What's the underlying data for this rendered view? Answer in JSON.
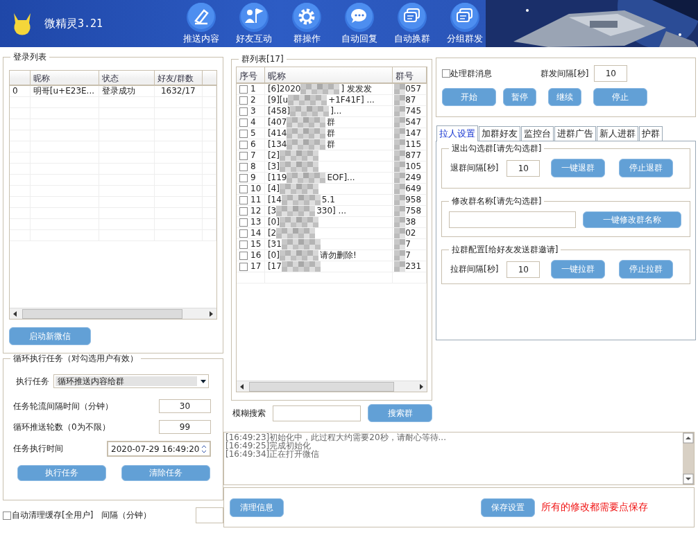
{
  "app": {
    "title": "微精灵",
    "version": "3.21"
  },
  "toolbar": [
    {
      "label": "推送内容"
    },
    {
      "label": "好友互动"
    },
    {
      "label": "群操作"
    },
    {
      "label": "自动回复"
    },
    {
      "label": "自动换群"
    },
    {
      "label": "分组群发"
    }
  ],
  "login_list": {
    "title": "登录列表",
    "columns": [
      "昵称",
      "状态",
      "好友/群数"
    ],
    "rows": [
      {
        "index": "0",
        "name": "明哥[u+E23E...",
        "status": "登录成功",
        "counts": "1632/17"
      }
    ]
  },
  "launch_button": "启动新微信",
  "loop_task": {
    "title": "循环执行任务（对勾选用户有效）",
    "task_label": "执行任务",
    "task_value": "循环推送内容给群",
    "interval_label": "任务轮流间隔时间（分钟）",
    "interval_value": "30",
    "rounds_label": "循环推送轮数（0为不限）",
    "rounds_value": "99",
    "time_label": "任务执行时间",
    "time_value": "2020-07-29 16:49:20",
    "buttons": [
      "执行任务",
      "清除任务"
    ]
  },
  "auto_clean": {
    "label": "自动清理缓存[全用户]",
    "checked": false,
    "interval_label": "间隔（分钟）"
  },
  "group_list": {
    "title": "群列表[17]",
    "columns": [
      "序号",
      "昵称",
      "群号"
    ],
    "rows": [
      {
        "index": "1",
        "checked": false,
        "name_start": "[6]2020",
        "name_end": "] 发发发",
        "id_end": "057"
      },
      {
        "index": "2",
        "checked": false,
        "name_start": "[9][u",
        "name_end": "+1F41F] ...",
        "id_end": "87"
      },
      {
        "index": "3",
        "checked": false,
        "name_start": "[458]",
        "name_end": "]...",
        "id_end": "745"
      },
      {
        "index": "4",
        "checked": false,
        "name_start": "[407",
        "name_end": "群",
        "id_end": "547"
      },
      {
        "index": "5",
        "checked": false,
        "name_start": "[414",
        "name_end": "群",
        "id_end": "147"
      },
      {
        "index": "6",
        "checked": false,
        "name_start": "[134",
        "name_end": "群",
        "id_end": "115"
      },
      {
        "index": "7",
        "checked": false,
        "name_start": "[2]",
        "id_end": "877"
      },
      {
        "index": "8",
        "checked": false,
        "name_start": "[3]",
        "id_end": "105"
      },
      {
        "index": "9",
        "checked": false,
        "name_start": "[119",
        "name_end": "EOF]...",
        "id_end": "249"
      },
      {
        "index": "10",
        "checked": false,
        "name_start": "[4]",
        "id_end": "649"
      },
      {
        "index": "11",
        "checked": false,
        "name_start": "[14",
        "name_end": "5.1",
        "id_end": "958"
      },
      {
        "index": "12",
        "checked": false,
        "name_start": "[3",
        "name_end": "330] ...",
        "id_end": "758"
      },
      {
        "index": "13",
        "checked": false,
        "name_start": "[0]",
        "id_end": "38"
      },
      {
        "index": "14",
        "checked": false,
        "name_start": "[2",
        "id_end": "02"
      },
      {
        "index": "15",
        "checked": false,
        "name_start": "[31",
        "id_end": "7"
      },
      {
        "index": "16",
        "checked": false,
        "name_start": "[0]",
        "name_end": "请勿删除!",
        "id_end": "7"
      },
      {
        "index": "17",
        "checked": false,
        "name_start": "[17",
        "id_end": "231"
      }
    ]
  },
  "search": {
    "label": "模糊搜索",
    "button": "搜索群"
  },
  "send": {
    "process_label": "处理群消息",
    "process_checked": false,
    "interval_label": "群发间隔[秒]",
    "interval_value": "10",
    "buttons": [
      "开始",
      "暂停",
      "继续",
      "停止"
    ]
  },
  "tabs": [
    {
      "label": "拉人设置",
      "selected": true
    },
    {
      "label": "加群好友",
      "selected": false
    },
    {
      "label": "监控台",
      "selected": false
    },
    {
      "label": "进群广告",
      "selected": false
    },
    {
      "label": "新人进群",
      "selected": false
    },
    {
      "label": "护群",
      "selected": false
    }
  ],
  "quit_groups": {
    "title": "退出勾选群[请先勾选群]",
    "interval_label": "退群间隔[秒]",
    "interval_value": "10",
    "buttons": [
      "一键退群",
      "停止退群"
    ]
  },
  "rename_groups": {
    "title": "修改群名称[请先勾选群]",
    "button": "一键修改群名称"
  },
  "invite": {
    "title": "拉群配置[给好友发送群邀请]",
    "interval_label": "拉群间隔[秒]",
    "interval_value": "10",
    "buttons": [
      "一键拉群",
      "停止拉群"
    ]
  },
  "log": [
    "[16:49:23]初始化中，此过程大约需要20秒，请耐心等待...",
    "[16:49:25]完成初始化",
    "[16:49:34]正在打开微信"
  ],
  "footer": {
    "clear_button": "清理信息",
    "save_button": "保存设置",
    "note": "所有的修改都需要点保存"
  }
}
